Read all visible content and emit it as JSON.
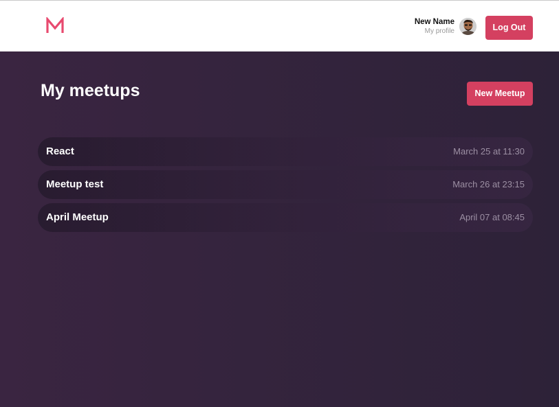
{
  "header": {
    "logo_icon": "m-logo-icon",
    "brand_color": "#e84a6f",
    "profile": {
      "name": "New Name",
      "link_label": "My profile",
      "avatar_icon": "user-avatar"
    },
    "logout_label": "Log Out"
  },
  "main": {
    "title": "My meetups",
    "new_meetup_label": "New Meetup",
    "meetups": [
      {
        "title": "React",
        "date": "March 25 at 11:30"
      },
      {
        "title": "Meetup test",
        "date": "March 26 at 23:15"
      },
      {
        "title": "April Meetup",
        "date": "April 07 at 08:45"
      }
    ]
  },
  "colors": {
    "accent": "#d44060",
    "background_start": "#3a2541",
    "background_end": "#2d2238",
    "header_bg": "#ffffff",
    "date_text": "#9c8fa3"
  }
}
